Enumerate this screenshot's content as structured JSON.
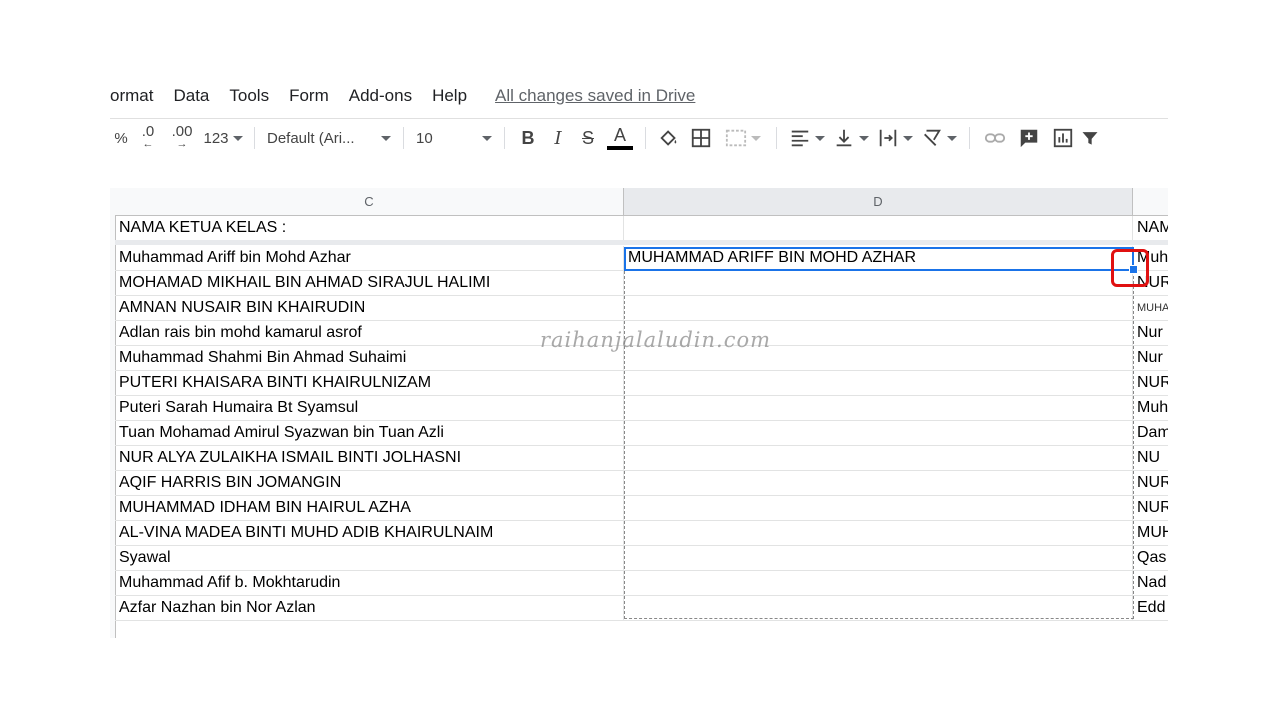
{
  "menu": {
    "items": [
      "ormat",
      "Data",
      "Tools",
      "Form",
      "Add-ons",
      "Help"
    ],
    "saved_status": "All changes saved in Drive"
  },
  "toolbar": {
    "percent": "%",
    "decrease_decimal": ".0",
    "increase_decimal": ".00",
    "number_format": "123",
    "font_family": "Default (Ari...",
    "font_size": "10",
    "bold": "B",
    "italic": "I",
    "strikethrough": "S",
    "text_color": "A"
  },
  "sheet": {
    "columns": [
      "C",
      "D"
    ],
    "header_row": {
      "c": "NAMA KETUA KELAS :",
      "d": "",
      "e": "NAM"
    },
    "rows": [
      {
        "c": "Muhammad Ariff bin Mohd Azhar",
        "d": "MUHAMMAD ARIFF BIN MOHD AZHAR",
        "e": "Muh"
      },
      {
        "c": "MOHAMAD MIKHAIL BIN AHMAD SIRAJUL HALIMI",
        "d": "",
        "e": "NUR"
      },
      {
        "c": "AMNAN NUSAIR BIN KHAIRUDIN",
        "d": "",
        "e": "MUHA"
      },
      {
        "c": "Adlan rais bin mohd kamarul asrof",
        "d": "",
        "e": "Nur"
      },
      {
        "c": "Muhammad Shahmi Bin Ahmad Suhaimi",
        "d": "",
        "e": "Nur"
      },
      {
        "c": "PUTERI KHAISARA BINTI KHAIRULNIZAM",
        "d": "",
        "e": "NUR"
      },
      {
        "c": "Puteri Sarah Humaira Bt Syamsul",
        "d": "",
        "e": "Muh"
      },
      {
        "c": "Tuan Mohamad Amirul Syazwan bin Tuan Azli",
        "d": "",
        "e": "Dam"
      },
      {
        "c": " NUR ALYA ZULAIKHA ISMAIL BINTI JOLHASNI",
        "d": "",
        "e": " NU"
      },
      {
        "c": "AQIF HARRIS BIN JOMANGIN",
        "d": "",
        "e": "NUR"
      },
      {
        "c": "MUHAMMAD IDHAM BIN HAIRUL AZHA",
        "d": "",
        "e": "NUR"
      },
      {
        "c": "AL-VINA MADEA BINTI MUHD ADIB KHAIRULNAIM",
        "d": "",
        "e": "MUH"
      },
      {
        "c": "Syawal",
        "d": "",
        "e": "Qas"
      },
      {
        "c": "Muhammad Afif b. Mokhtarudin",
        "d": "",
        "e": "Nad"
      },
      {
        "c": "Azfar Nazhan bin Nor Azlan",
        "d": "",
        "e": "Edd"
      }
    ]
  },
  "watermark": "raihanjalaludin.com",
  "colors": {
    "selection": "#1a73e8",
    "highlight": "#e01010",
    "header_bg": "#f8f9fa"
  }
}
